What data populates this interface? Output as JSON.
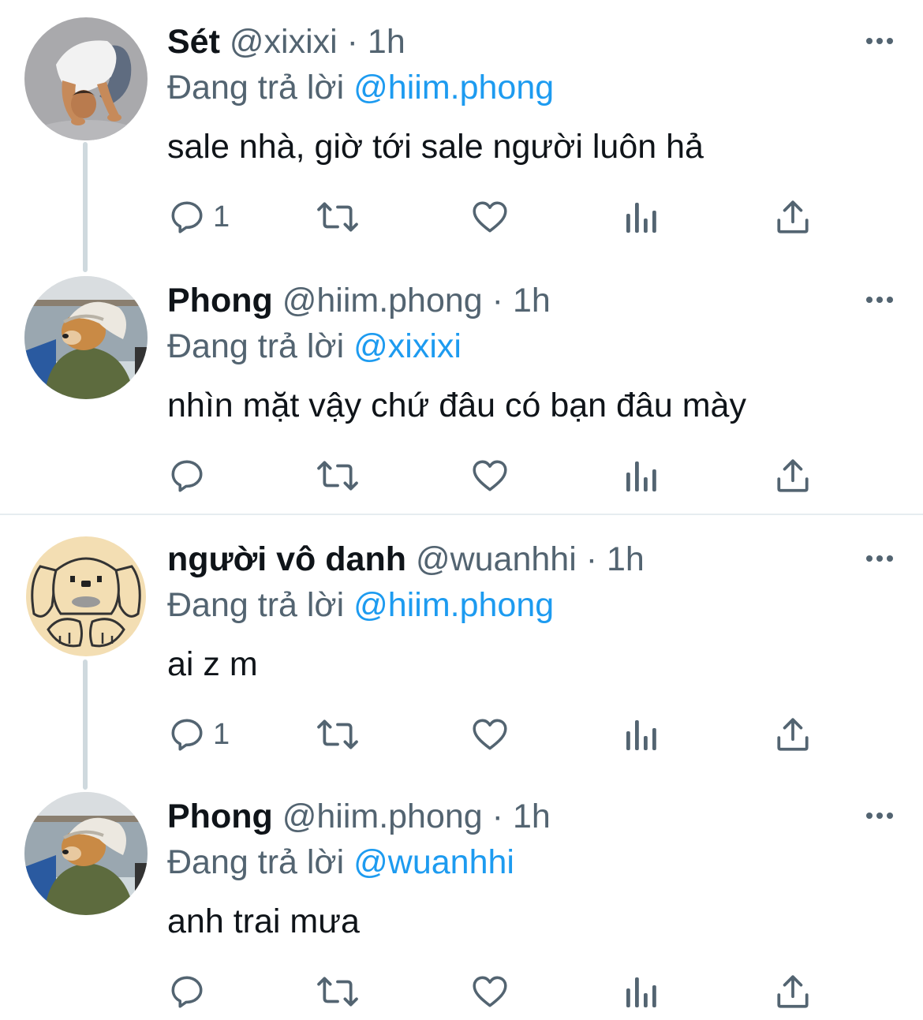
{
  "tweets": [
    {
      "display_name": "Sét",
      "handle": "@xixixi",
      "separator": "·",
      "time": "1h",
      "reply_prefix": "Đang trả lời",
      "reply_to": "@hiim.phong",
      "text": "sale nhà, giờ tới sale người luôn hả",
      "reply_count": "1",
      "avatar_icon": "kneeling-person-avatar"
    },
    {
      "display_name": "Phong",
      "handle": "@hiim.phong",
      "separator": "·",
      "time": "1h",
      "reply_prefix": "Đang trả lời",
      "reply_to": "@xixixi",
      "text": "nhìn mặt vậy chứ đâu có bạn đâu mày",
      "reply_count": "",
      "avatar_icon": "dog-in-hat-avatar"
    },
    {
      "display_name": "người vô danh",
      "handle": "@wuanhhi",
      "separator": "·",
      "time": "1h",
      "reply_prefix": "Đang trả lời",
      "reply_to": "@hiim.phong",
      "text": "ai z m",
      "reply_count": "1",
      "avatar_icon": "cartoon-dog-avatar"
    },
    {
      "display_name": "Phong",
      "handle": "@hiim.phong",
      "separator": "·",
      "time": "1h",
      "reply_prefix": "Đang trả lời",
      "reply_to": "@wuanhhi",
      "text": "anh trai mưa",
      "reply_count": "",
      "avatar_icon": "dog-in-hat-avatar"
    }
  ],
  "colors": {
    "text_primary": "#0f1419",
    "text_secondary": "#536471",
    "link": "#1d9bf0",
    "thread_line": "#cfd9de",
    "icon": "#536471"
  },
  "action_icons": [
    "reply-icon",
    "retweet-icon",
    "like-icon",
    "analytics-icon",
    "share-icon"
  ]
}
